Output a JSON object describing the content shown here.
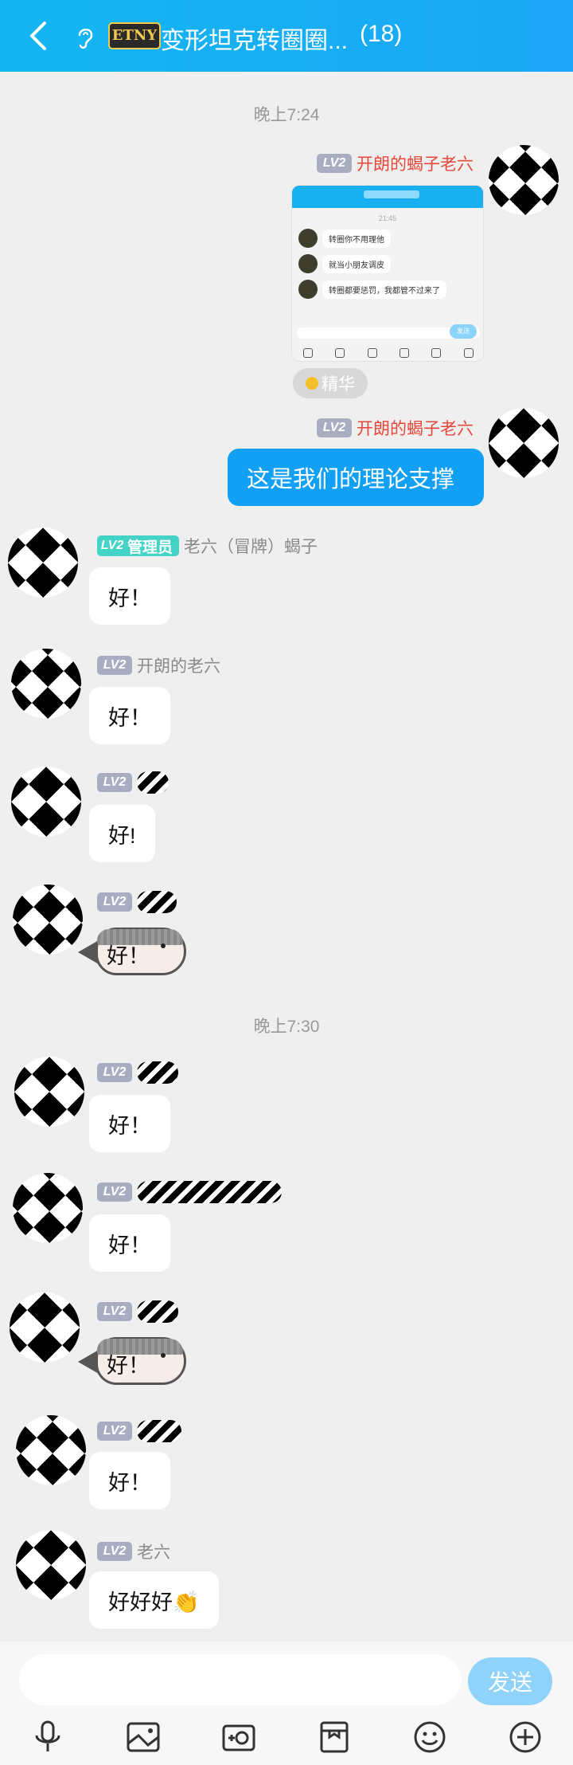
{
  "header": {
    "badge": "ETNY",
    "title": "变形坦克转圈圈...",
    "count": "(18)"
  },
  "time_dividers": [
    "晚上7:24",
    "晚上7:30"
  ],
  "level_badge": "LV2",
  "messages": [
    {
      "name": "开朗的蝎子老六",
      "preview": {
        "time": "21:45",
        "lines": [
          "转圈你不用理他",
          "就当小朋友调皮",
          "转圈都要惩罚，我都管不过来了"
        ],
        "send": "发送"
      },
      "tag": "精华"
    },
    {
      "name": "开朗的蝎子老六",
      "text": "这是我们的理论支撑"
    },
    {
      "role": "管理员",
      "name": "老六（冒牌）蝎子",
      "text": "好！"
    },
    {
      "name": "开朗的老六",
      "text": "好！"
    },
    {
      "text": "好!"
    },
    {
      "text": "好！"
    },
    {
      "text": "好！"
    },
    {
      "text": "好！"
    },
    {
      "text": "好！"
    },
    {
      "text": "好！"
    },
    {
      "name": "老六",
      "text": "好好好👏"
    }
  ],
  "composer": {
    "send": "发送"
  },
  "icons": [
    "back-icon",
    "ear-icon",
    "mic-icon",
    "image-icon",
    "camera-icon",
    "file-icon",
    "emoji-icon",
    "plus-icon"
  ]
}
